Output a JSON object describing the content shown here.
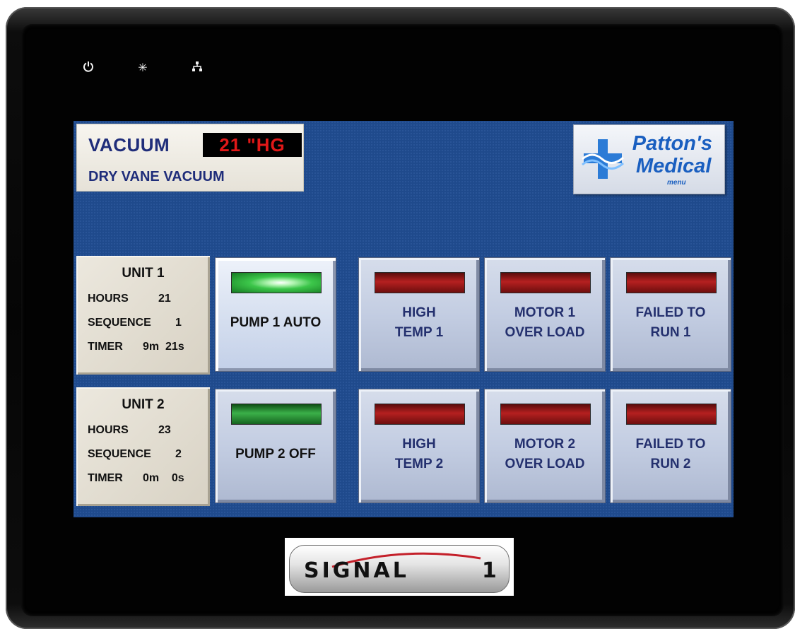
{
  "status_icons": [
    "power-icon",
    "brightness-icon",
    "network-icon"
  ],
  "header": {
    "title": "VACUUM",
    "reading": "21 \"HG",
    "system": "DRY VANE VACUUM"
  },
  "logo": {
    "name_line1": "Patton's",
    "name_line2": "Medical",
    "menu": "menu"
  },
  "units": [
    {
      "title": "UNIT 1",
      "hours_label": "HOURS",
      "hours": "21",
      "sequence_label": "SEQUENCE",
      "sequence": "1",
      "timer_label": "TIMER",
      "timer": "9m  21s",
      "pump": {
        "line1": "PUMP 1 AUTO",
        "lamp": "green-on"
      },
      "alarms": [
        {
          "line1": "HIGH",
          "line2": "TEMP 1",
          "lamp": "red"
        },
        {
          "line1": "MOTOR 1",
          "line2": "OVER LOAD",
          "lamp": "red"
        },
        {
          "line1": "FAILED TO",
          "line2": "RUN 1",
          "lamp": "red"
        }
      ]
    },
    {
      "title": "UNIT 2",
      "hours_label": "HOURS",
      "hours": "23",
      "sequence_label": "SEQUENCE",
      "sequence": "2",
      "timer_label": "TIMER",
      "timer": "0m    0s",
      "pump": {
        "line1": "PUMP 2 OFF",
        "lamp": "green"
      },
      "alarms": [
        {
          "line1": "HIGH",
          "line2": "TEMP 2",
          "lamp": "red"
        },
        {
          "line1": "MOTOR 2",
          "line2": "OVER LOAD",
          "lamp": "red"
        },
        {
          "line1": "FAILED TO",
          "line2": "RUN 2",
          "lamp": "red"
        }
      ]
    }
  ],
  "brand": {
    "text": "SIGNAL",
    "number": "1"
  },
  "colors": {
    "screen_bg": "#1f4a8c",
    "title_text": "#1f2d7a",
    "reading_text": "#e01818",
    "alarm_lamp": "#b52020",
    "pump_lamp": "#3bb049"
  }
}
